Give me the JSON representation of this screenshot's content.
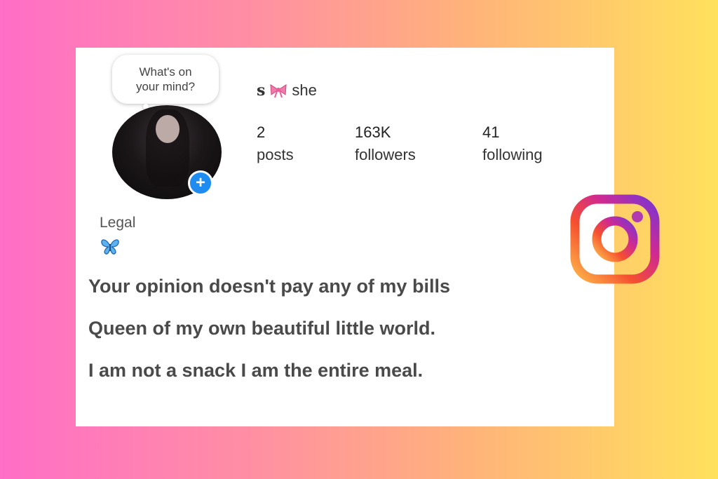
{
  "bubble": {
    "line1": "What's on",
    "line2": "your mind?"
  },
  "profile": {
    "name_letter": "s",
    "name_text": "she",
    "stats": [
      {
        "num": "2",
        "label": "posts"
      },
      {
        "num": "163K",
        "label": "followers"
      },
      {
        "num": "41",
        "label": "following"
      }
    ],
    "bio_category": "Legal",
    "bio_icon": "butterfly-icon",
    "bow_icon": "pink-bow-icon"
  },
  "quotes": [
    "Your opinion doesn't pay any of my bills",
    "Queen of my own beautiful little world.",
    "I am not a snack I am the entire meal."
  ],
  "colors": {
    "accent": "#1e8cf0",
    "bow": "#e8609a",
    "butterfly": "#2a8fd8"
  },
  "logo": "instagram-logo-icon"
}
